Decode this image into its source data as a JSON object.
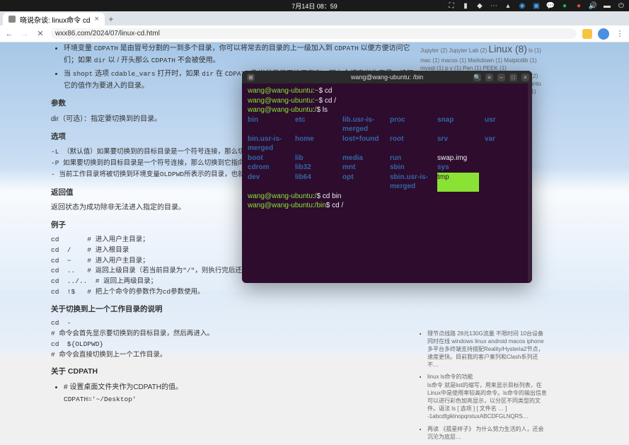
{
  "system": {
    "clock": "7月14日 08：59"
  },
  "browser": {
    "tab_title": "晓说杂谈: linux命令 cd",
    "url": "wxx86.com/2024/07/linux-cd.html"
  },
  "article": {
    "env_li1_a": "环境变量 ",
    "env_li1_code": "CDPATH",
    "env_li1_b": " 是由冒号分割的一到多个目录，你可以将常去的目录的上一级加入到 ",
    "env_li1_code2": "CDPATH",
    "env_li1_c": " 以便方便访问它们；如果 ",
    "env_li1_code3": "dir",
    "env_li1_d": " 以 / 开头那么 ",
    "env_li1_code4": "CDPATH",
    "env_li1_e": " 不会被使用。",
    "env_li2_a": "当 ",
    "env_li2_code1": "shopt",
    "env_li2_b": " 选项 ",
    "env_li2_code2": "cdable_vars",
    "env_li2_c": " 打开时，如果 ",
    "env_li2_code3": "dir",
    "env_li2_d": " 在 ",
    "env_li2_code4": "CDPATH",
    "env_li2_e": " 及当前目录下均不存在，那么会把它当作变量，读取它的值作为要进入的目录。",
    "h_params": "参数",
    "params_text": "dir（可选）：指定要切换到的目录。",
    "h_options": "选项",
    "opt_L": "-L   （默认值）如果要切换到的目标目录是一个符号连接，那么切换到…",
    "opt_P": "-P   如果要切换到的目标目录是一个符号连接，那么切换到它指向的物…",
    "opt_dash": "-    当前工作目录将被切换到环境变量OLDPWD所表示的目录，也就是…",
    "h_return": "返回值",
    "return_text": "返回状态为成功除非无法进入指定的目录。",
    "h_example": "例子",
    "examples": "cd       # 进入用户主目录；\ncd  /    # 进入根目录\ncd  ~    # 进入用户主目录；\ncd  ..   # 返回上级目录（若当前目录为\"/\"，则执行完后还在\"/\"；\"…\"\ncd  ../..  # 返回上两级目录；\ncd  !$   # 把上个命令的参数作为cd参数使用。",
    "h_prev": "关于切换到上一个工作目录的说明",
    "prev_block": "cd  -\n# 命令会首先显示要切换到的目标目录，然后再进入。\ncd  ${OLDPWD}\n# 命令会直接切换到上一个工作目录。",
    "h_cdpath": "关于 CDPATH",
    "cdpath_li": "# 设置桌面文件夹作为CDPATH的值。",
    "cdpath_code": "CDPATH='~/Desktop'"
  },
  "sidebar": {
    "tags_html": "Jupyter (2) Jupyter Lab (2) <span class=\"tag-big\">Linux (8)</span> ls (1) mac (1) macos (1) Markdown (1) Matplotlib (1) mysql (1) p y (1) Pen (1) PEEK (1) Polyetheretherketone (1) PTFE (1) pymysql (2) python (1) Shadowrocks (1) sing-box (1) Ubuntu (3) v2rayN (1) windows (2) Xvnn (1) xrandr (1)",
    "item1": "理节点线路 28元130G流量 不限时间 10台设备同时在线 windows linux android macos iphone 多平台多终端支持搭配Reality/Hysteria2节点，速度更快。目前我的客户案列和Clash系列还不…",
    "item2_title": "linux ls命令的功能",
    "item2_body": "ls命令 就是list的缩写，用来显示目标列表，在Linux中是使用率较高的命令。ls命令的输出信息可以进行彩色加亮显示，以分区不同类型的文件。语法 ls [ 选项 ] [ 文件名 … ] -1abcdfgiklnopqrstuxABCDFGLNQRS…",
    "item3": "再读 《孤星样子》 为什么努力生活的人，还会沉沦为底层…"
  },
  "terminal": {
    "title": "wang@wang-ubuntu: /bin",
    "prompt_user": "wang@wang-ubuntu",
    "line1_path": "~",
    "line1_cmd": "cd",
    "line2_path": "~",
    "line2_cmd": "cd /",
    "line3_path": "/",
    "line3_cmd": "ls",
    "ls": [
      [
        "bin",
        "dir"
      ],
      [
        "etc",
        "dir"
      ],
      [
        "lib.usr-is-merged",
        "dir"
      ],
      [
        "proc",
        "dir"
      ],
      [
        "snap",
        "dir"
      ],
      [
        "usr",
        "dir"
      ],
      [
        "bin.usr-is-merged",
        "dir"
      ],
      [
        "home",
        "dir"
      ],
      [
        "lost+found",
        "dir"
      ],
      [
        "root",
        "dir"
      ],
      [
        "srv",
        "dir"
      ],
      [
        "var",
        "dir"
      ],
      [
        "boot",
        "dir"
      ],
      [
        "lib",
        "dir"
      ],
      [
        "media",
        "dir"
      ],
      [
        "run",
        "dir"
      ],
      [
        "swap.img",
        "file"
      ],
      [
        "",
        ""
      ],
      [
        "cdrom",
        "dir"
      ],
      [
        "lib32",
        "dir"
      ],
      [
        "mnt",
        "dir"
      ],
      [
        "sbin",
        "dir"
      ],
      [
        "sys",
        "dir"
      ],
      [
        "",
        ""
      ],
      [
        "dev",
        "dir"
      ],
      [
        "lib64",
        "dir"
      ],
      [
        "opt",
        "dir"
      ],
      [
        "sbin.usr-is-merged",
        "dir"
      ],
      [
        "tmp",
        "hl"
      ],
      [
        "",
        ""
      ]
    ],
    "line4_path": "/",
    "line4_cmd": "cd bin",
    "line5_path": "/bin",
    "line5_cmd": "cd /"
  }
}
